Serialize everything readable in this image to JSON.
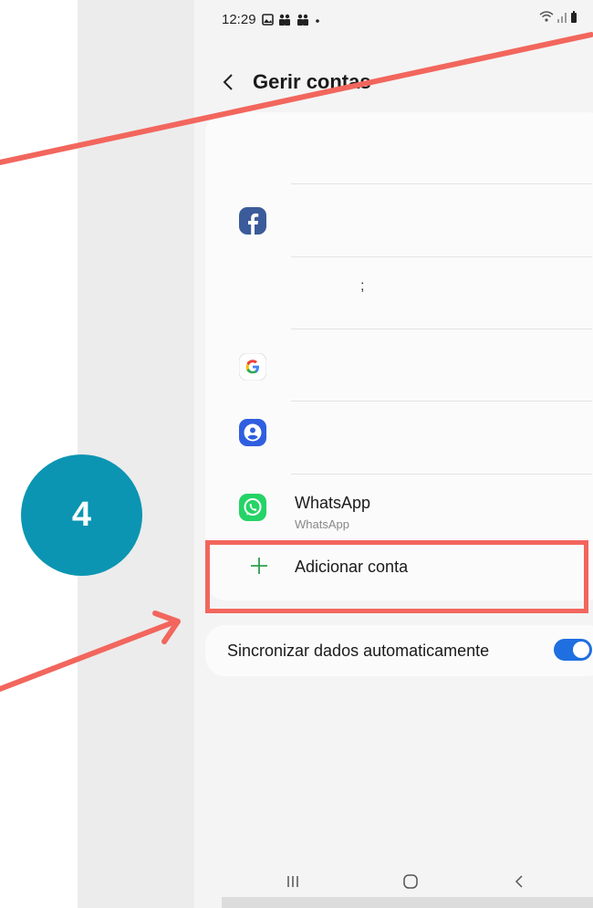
{
  "status_bar": {
    "time": "12:29",
    "left_icons": [
      "image-icon",
      "people-icon",
      "people-icon",
      "dot-icon"
    ],
    "right_icons": [
      "wifi-icon",
      "signal-icon",
      "battery-icon"
    ]
  },
  "header": {
    "back_icon": "chevron-left-icon",
    "title": "Gerir contas"
  },
  "accounts": [
    {
      "icon": "facebook-icon",
      "name": "",
      "sub": ""
    },
    {
      "icon": "",
      "name": ";",
      "sub": ""
    },
    {
      "icon": "google-icon",
      "name": "",
      "sub": ""
    },
    {
      "icon": "samsung-account-icon",
      "name": "",
      "sub": ""
    },
    {
      "icon": "whatsapp-icon",
      "name": "WhatsApp",
      "sub": "WhatsApp"
    }
  ],
  "add_account": {
    "icon": "plus-icon",
    "label": "Adicionar conta"
  },
  "sync": {
    "label": "Sincronizar dados automaticamente",
    "enabled": true
  },
  "nav_bar": [
    "recents-icon",
    "home-icon",
    "back-icon"
  ],
  "annotation": {
    "step_number": "4",
    "badge_color": "#0b95b2",
    "arrow_color": "#f2665d"
  },
  "colors": {
    "accent": "#1f6fe0",
    "facebook": "#1877f2",
    "whatsapp": "#25d366",
    "add_plus": "#2f9e4f"
  }
}
